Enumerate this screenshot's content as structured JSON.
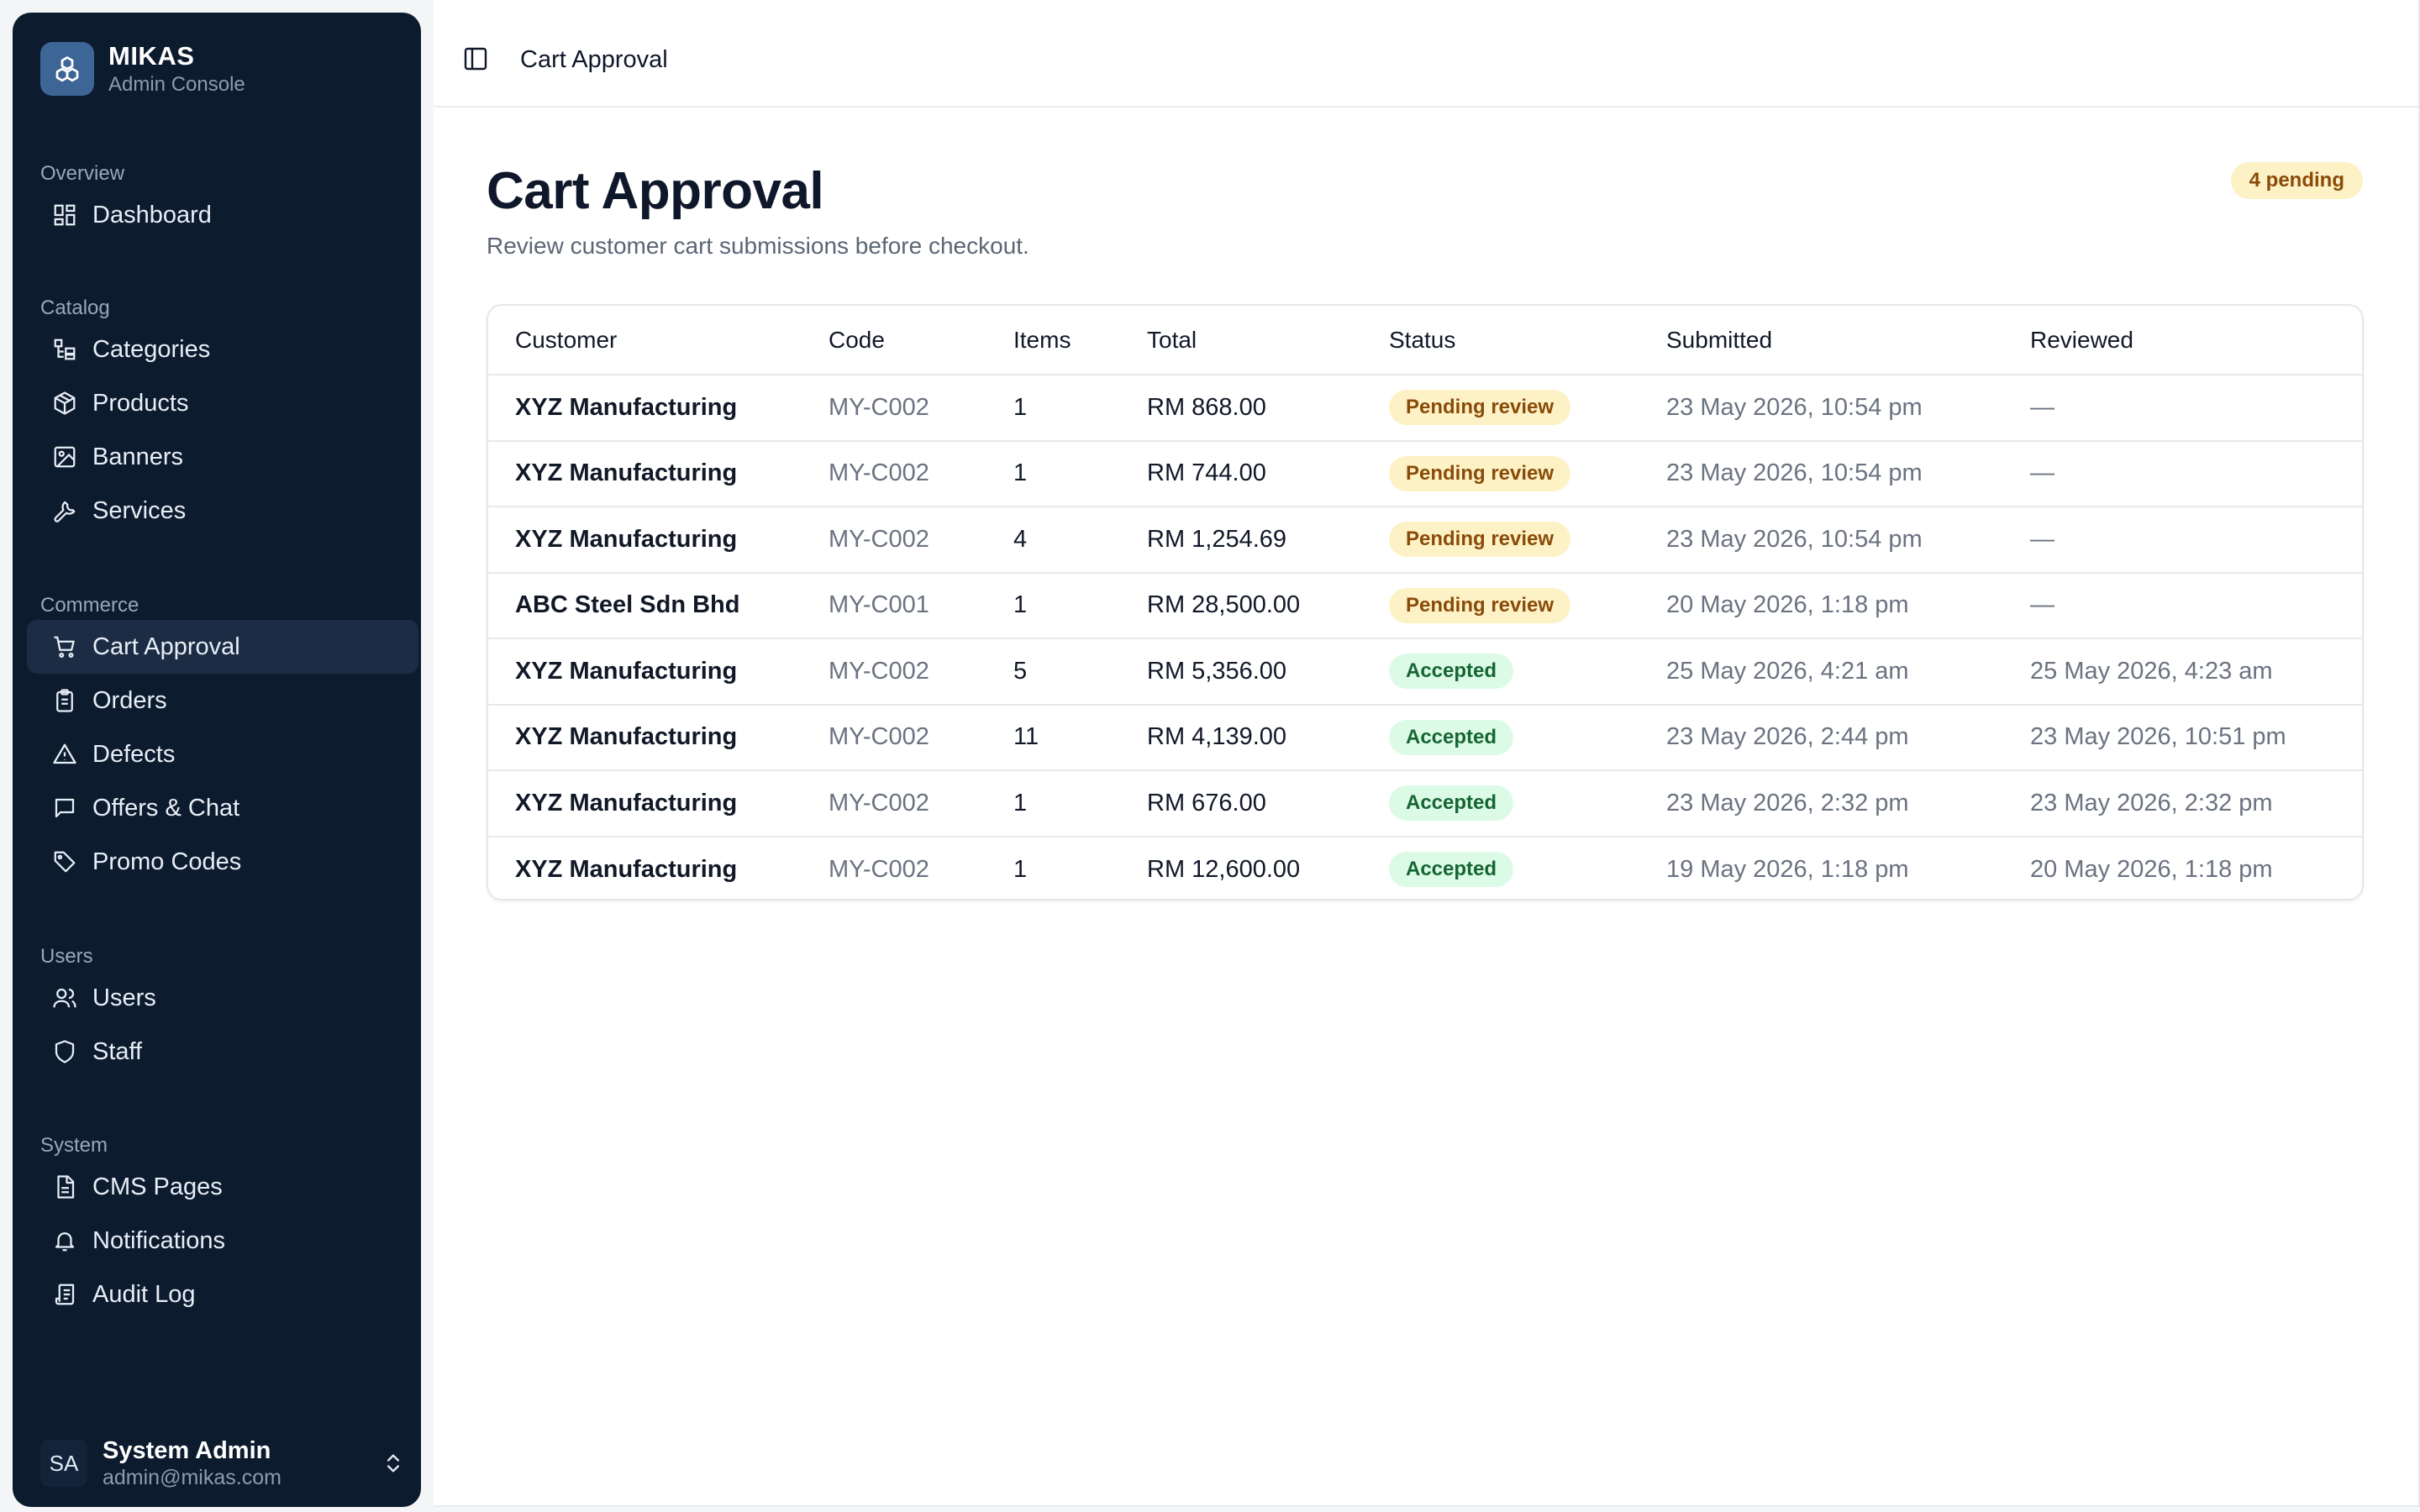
{
  "brand": {
    "name": "MIKAS",
    "subtitle": "Admin Console"
  },
  "sidebar": {
    "sections": [
      {
        "title": "Overview",
        "items": [
          {
            "label": "Dashboard",
            "icon": "dashboard-icon"
          }
        ]
      },
      {
        "title": "Catalog",
        "items": [
          {
            "label": "Categories",
            "icon": "categories-icon"
          },
          {
            "label": "Products",
            "icon": "box-icon"
          },
          {
            "label": "Banners",
            "icon": "image-icon"
          },
          {
            "label": "Services",
            "icon": "wrench-icon"
          }
        ]
      },
      {
        "title": "Commerce",
        "items": [
          {
            "label": "Cart Approval",
            "icon": "cart-icon",
            "active": true
          },
          {
            "label": "Orders",
            "icon": "clipboard-icon"
          },
          {
            "label": "Defects",
            "icon": "warning-icon"
          },
          {
            "label": "Offers & Chat",
            "icon": "chat-icon"
          },
          {
            "label": "Promo Codes",
            "icon": "tag-icon"
          }
        ]
      },
      {
        "title": "Users",
        "items": [
          {
            "label": "Users",
            "icon": "users-icon"
          },
          {
            "label": "Staff",
            "icon": "shield-icon"
          }
        ]
      },
      {
        "title": "System",
        "items": [
          {
            "label": "CMS Pages",
            "icon": "document-icon"
          },
          {
            "label": "Notifications",
            "icon": "bell-icon"
          },
          {
            "label": "Audit Log",
            "icon": "audit-log-icon"
          }
        ]
      }
    ]
  },
  "user": {
    "initials": "SA",
    "name": "System Admin",
    "email": "admin@mikas.com"
  },
  "topbar": {
    "title": "Cart Approval"
  },
  "page": {
    "title": "Cart Approval",
    "subtitle": "Review customer cart submissions before checkout.",
    "pending_badge": "4 pending"
  },
  "table": {
    "columns": [
      "Customer",
      "Code",
      "Items",
      "Total",
      "Status",
      "Submitted",
      "Reviewed"
    ],
    "rows": [
      {
        "customer": "XYZ Manufacturing",
        "code": "MY-C002",
        "items": "1",
        "total": "RM 868.00",
        "status": "Pending review",
        "status_kind": "pending",
        "submitted": "23 May 2026, 10:54 pm",
        "reviewed": "—"
      },
      {
        "customer": "XYZ Manufacturing",
        "code": "MY-C002",
        "items": "1",
        "total": "RM 744.00",
        "status": "Pending review",
        "status_kind": "pending",
        "submitted": "23 May 2026, 10:54 pm",
        "reviewed": "—"
      },
      {
        "customer": "XYZ Manufacturing",
        "code": "MY-C002",
        "items": "4",
        "total": "RM 1,254.69",
        "status": "Pending review",
        "status_kind": "pending",
        "submitted": "23 May 2026, 10:54 pm",
        "reviewed": "—"
      },
      {
        "customer": "ABC Steel Sdn Bhd",
        "code": "MY-C001",
        "items": "1",
        "total": "RM 28,500.00",
        "status": "Pending review",
        "status_kind": "pending",
        "submitted": "20 May 2026, 1:18 pm",
        "reviewed": "—"
      },
      {
        "customer": "XYZ Manufacturing",
        "code": "MY-C002",
        "items": "5",
        "total": "RM 5,356.00",
        "status": "Accepted",
        "status_kind": "accepted",
        "submitted": "25 May 2026, 4:21 am",
        "reviewed": "25 May 2026, 4:23 am"
      },
      {
        "customer": "XYZ Manufacturing",
        "code": "MY-C002",
        "items": "11",
        "total": "RM 4,139.00",
        "status": "Accepted",
        "status_kind": "accepted",
        "submitted": "23 May 2026, 2:44 pm",
        "reviewed": "23 May 2026, 10:51 pm"
      },
      {
        "customer": "XYZ Manufacturing",
        "code": "MY-C002",
        "items": "1",
        "total": "RM 676.00",
        "status": "Accepted",
        "status_kind": "accepted",
        "submitted": "23 May 2026, 2:32 pm",
        "reviewed": "23 May 2026, 2:32 pm"
      },
      {
        "customer": "XYZ Manufacturing",
        "code": "MY-C002",
        "items": "1",
        "total": "RM 12,600.00",
        "status": "Accepted",
        "status_kind": "accepted",
        "submitted": "19 May 2026, 1:18 pm",
        "reviewed": "20 May 2026, 1:18 pm"
      }
    ]
  },
  "colors": {
    "sidebar_bg": "#0d1b2e",
    "active_item_bg": "#1c2c44",
    "pending_bg": "#fdf1c6",
    "pending_text": "#8a4b08",
    "accepted_bg": "#dcfbe6",
    "accepted_text": "#166534"
  }
}
